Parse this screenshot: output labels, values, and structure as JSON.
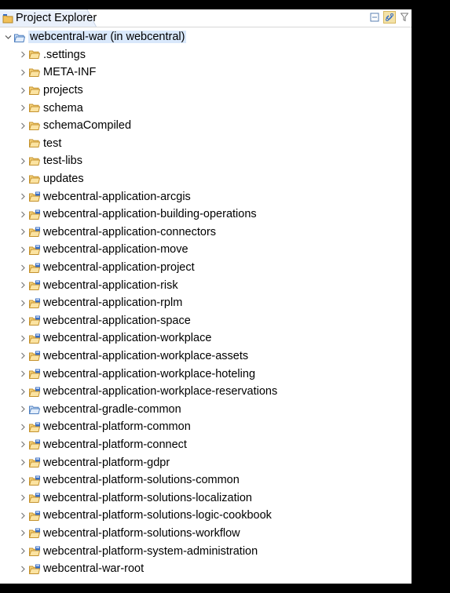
{
  "view": {
    "title": "Project Explorer"
  },
  "toolbar": {
    "icons": [
      "collapse-all-icon",
      "link-with-editor-icon",
      "filter-icon"
    ]
  },
  "tree": {
    "root": {
      "label": "webcentral-war (in webcentral)",
      "expanded": true
    },
    "items": [
      {
        "label": ".settings",
        "type": "folder",
        "has_arrow": true
      },
      {
        "label": "META-INF",
        "type": "folder",
        "has_arrow": true
      },
      {
        "label": "projects",
        "type": "folder",
        "has_arrow": true
      },
      {
        "label": "schema",
        "type": "folder",
        "has_arrow": true
      },
      {
        "label": "schemaCompiled",
        "type": "folder",
        "has_arrow": true
      },
      {
        "label": "test",
        "type": "folder",
        "has_arrow": false
      },
      {
        "label": "test-libs",
        "type": "folder",
        "has_arrow": true
      },
      {
        "label": "updates",
        "type": "folder",
        "has_arrow": true
      },
      {
        "label": "webcentral-application-arcgis",
        "type": "project",
        "has_arrow": true
      },
      {
        "label": "webcentral-application-building-operations",
        "type": "project",
        "has_arrow": true
      },
      {
        "label": "webcentral-application-connectors",
        "type": "project",
        "has_arrow": true
      },
      {
        "label": "webcentral-application-move",
        "type": "project",
        "has_arrow": true
      },
      {
        "label": "webcentral-application-project",
        "type": "project",
        "has_arrow": true
      },
      {
        "label": "webcentral-application-risk",
        "type": "project",
        "has_arrow": true
      },
      {
        "label": "webcentral-application-rplm",
        "type": "project",
        "has_arrow": true
      },
      {
        "label": "webcentral-application-space",
        "type": "project",
        "has_arrow": true
      },
      {
        "label": "webcentral-application-workplace",
        "type": "project",
        "has_arrow": true
      },
      {
        "label": "webcentral-application-workplace-assets",
        "type": "project",
        "has_arrow": true
      },
      {
        "label": "webcentral-application-workplace-hoteling",
        "type": "project",
        "has_arrow": true
      },
      {
        "label": "webcentral-application-workplace-reservations",
        "type": "project",
        "has_arrow": true
      },
      {
        "label": "webcentral-gradle-common",
        "type": "project-folder",
        "has_arrow": true
      },
      {
        "label": "webcentral-platform-common",
        "type": "project",
        "has_arrow": true
      },
      {
        "label": "webcentral-platform-connect",
        "type": "project",
        "has_arrow": true
      },
      {
        "label": "webcentral-platform-gdpr",
        "type": "project",
        "has_arrow": true
      },
      {
        "label": "webcentral-platform-solutions-common",
        "type": "project",
        "has_arrow": true
      },
      {
        "label": "webcentral-platform-solutions-localization",
        "type": "project",
        "has_arrow": true
      },
      {
        "label": "webcentral-platform-solutions-logic-cookbook",
        "type": "project",
        "has_arrow": true
      },
      {
        "label": "webcentral-platform-solutions-workflow",
        "type": "project",
        "has_arrow": true
      },
      {
        "label": "webcentral-platform-system-administration",
        "type": "project",
        "has_arrow": true
      },
      {
        "label": "webcentral-war-root",
        "type": "project",
        "has_arrow": true
      }
    ]
  },
  "colors": {
    "folder": "#e8b04a",
    "project_badge": "#3a6fc4",
    "selection": "#d9e8fb"
  }
}
